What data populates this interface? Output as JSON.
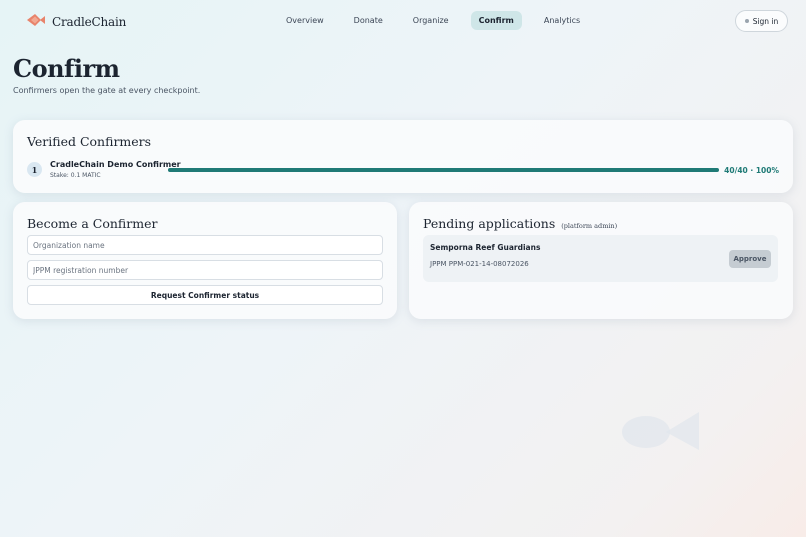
{
  "brand": {
    "name": "CradleChain",
    "logo_icon": "fish-icon",
    "logo_color": "#e8836b"
  },
  "nav": {
    "items": [
      {
        "label": "Overview",
        "active": false
      },
      {
        "label": "Donate",
        "active": false
      },
      {
        "label": "Organize",
        "active": false
      },
      {
        "label": "Confirm",
        "active": true
      },
      {
        "label": "Analytics",
        "active": false
      }
    ]
  },
  "signin": {
    "label": "Sign in"
  },
  "page": {
    "title": "Confirm",
    "subtitle": "Confirmers open the gate at every checkpoint."
  },
  "verified": {
    "title": "Verified Confirmers",
    "confirmers": [
      {
        "rank": "1",
        "name": "CradleChain Demo Confirmer",
        "stake": "Stake: 0.1 MATIC",
        "progress_text": "40/40 · 100%",
        "progress": 1.0
      }
    ]
  },
  "become": {
    "title": "Become a Confirmer",
    "org_placeholder": "Organization name",
    "jppm_placeholder": "JPPM registration number",
    "submit_label": "Request Confirmer status"
  },
  "pending": {
    "title": "Pending applications",
    "subtitle": "(platform admin)",
    "applications": [
      {
        "name": "Semporna Reef Guardians",
        "registration": "JPPM PPM-021-14-08072026",
        "action_label": "Approve"
      }
    ]
  },
  "colors": {
    "accent": "#1f7a76",
    "active_tab": "#cfe6e8"
  }
}
